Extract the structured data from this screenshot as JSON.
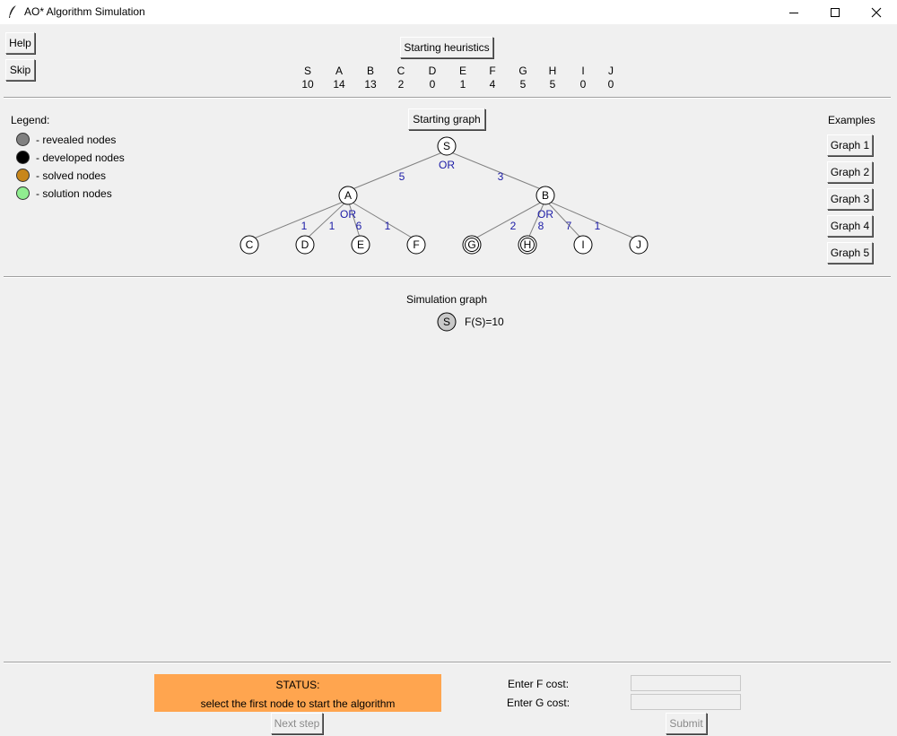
{
  "window": {
    "title": "AO* Algorithm Simulation",
    "icon": "feather-icon"
  },
  "side_buttons": {
    "help": "Help",
    "skip": "Skip"
  },
  "heuristics": {
    "button": "Starting heuristics",
    "items": [
      {
        "node": "S",
        "value": "10"
      },
      {
        "node": "A",
        "value": "14"
      },
      {
        "node": "B",
        "value": "13"
      },
      {
        "node": "C",
        "value": "2"
      },
      {
        "node": "D",
        "value": "0"
      },
      {
        "node": "E",
        "value": "1"
      },
      {
        "node": "F",
        "value": "4"
      },
      {
        "node": "G",
        "value": "5"
      },
      {
        "node": "H",
        "value": "5"
      },
      {
        "node": "I",
        "value": "0"
      },
      {
        "node": "J",
        "value": "0"
      }
    ]
  },
  "legend": {
    "title": "Legend:",
    "items": [
      {
        "label": "- revealed nodes",
        "color": "#808080"
      },
      {
        "label": "- developed nodes",
        "color": "#000000"
      },
      {
        "label": "- solved nodes",
        "color": "#c8861a"
      },
      {
        "label": "- solution nodes",
        "color": "#90ee90"
      }
    ]
  },
  "starting_graph": {
    "button": "Starting graph",
    "edge_labels": [
      "5",
      "3",
      "1",
      "1",
      "6",
      "1",
      "2",
      "8",
      "7",
      "1"
    ],
    "or_labels": [
      "OR",
      "OR",
      "OR"
    ],
    "nodes": [
      "S",
      "A",
      "B",
      "C",
      "D",
      "E",
      "F",
      "G",
      "H",
      "I",
      "J"
    ],
    "double_circled": [
      "G",
      "H"
    ]
  },
  "examples": {
    "title": "Examples",
    "buttons": [
      "Graph 1",
      "Graph 2",
      "Graph 3",
      "Graph 4",
      "Graph 5"
    ]
  },
  "simulation": {
    "title": "Simulation graph",
    "node": "S",
    "f_label": "F(S)=10"
  },
  "status": {
    "title": "STATUS:",
    "message": "select the first node to start the algorithm",
    "color": "#ffa54f"
  },
  "controls": {
    "next_step": "Next step",
    "f_cost_label": "Enter F cost:",
    "g_cost_label": "Enter G cost:",
    "f_cost_value": "",
    "g_cost_value": "",
    "submit": "Submit"
  }
}
